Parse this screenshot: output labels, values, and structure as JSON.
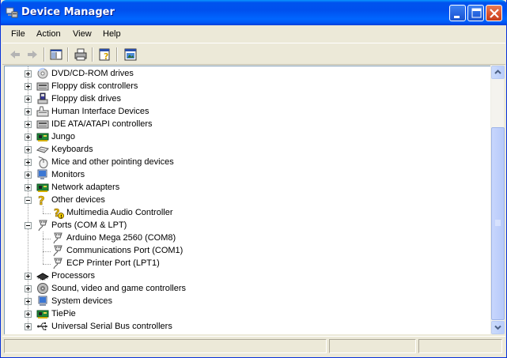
{
  "window": {
    "title": "Device Manager",
    "accent_color": "#0054e3",
    "controls": [
      "minimize-icon",
      "maximize-icon",
      "close-icon"
    ]
  },
  "menu": {
    "items": [
      "File",
      "Action",
      "View",
      "Help"
    ]
  },
  "toolbar": {
    "tools": [
      "back-arrow-icon",
      "forward-arrow-icon",
      "show-hide-console-tree-icon",
      "print-icon",
      "help-icon",
      "properties-icon"
    ]
  },
  "tree": {
    "items": [
      {
        "label": "DVD/CD-ROM drives",
        "icon": "dvd-drive-icon",
        "state": "collapsed"
      },
      {
        "label": "Floppy disk controllers",
        "icon": "controller-icon",
        "state": "collapsed"
      },
      {
        "label": "Floppy disk drives",
        "icon": "floppy-drive-icon",
        "state": "collapsed"
      },
      {
        "label": "Human Interface Devices",
        "icon": "hid-icon",
        "state": "collapsed"
      },
      {
        "label": "IDE ATA/ATAPI controllers",
        "icon": "ide-controller-icon",
        "state": "collapsed"
      },
      {
        "label": "Jungo",
        "icon": "board-icon",
        "state": "collapsed"
      },
      {
        "label": "Keyboards",
        "icon": "keyboard-icon",
        "state": "collapsed"
      },
      {
        "label": "Mice and other pointing devices",
        "icon": "mouse-icon",
        "state": "collapsed"
      },
      {
        "label": "Monitors",
        "icon": "monitor-icon",
        "state": "collapsed"
      },
      {
        "label": "Network adapters",
        "icon": "network-adapter-icon",
        "state": "collapsed"
      },
      {
        "label": "Other devices",
        "icon": "question-icon",
        "state": "expanded",
        "children": [
          {
            "label": "Multimedia Audio Controller",
            "icon": "warning-question-icon"
          }
        ]
      },
      {
        "label": "Ports (COM & LPT)",
        "icon": "port-icon",
        "state": "expanded",
        "children": [
          {
            "label": "Arduino Mega 2560 (COM8)",
            "icon": "port-icon"
          },
          {
            "label": "Communications Port (COM1)",
            "icon": "port-icon"
          },
          {
            "label": "ECP Printer Port (LPT1)",
            "icon": "port-icon"
          }
        ]
      },
      {
        "label": "Processors",
        "icon": "processor-icon",
        "state": "collapsed"
      },
      {
        "label": "Sound, video and game controllers",
        "icon": "sound-icon",
        "state": "collapsed"
      },
      {
        "label": "System devices",
        "icon": "system-icon",
        "state": "collapsed"
      },
      {
        "label": "TiePie",
        "icon": "board-icon",
        "state": "collapsed"
      },
      {
        "label": "Universal Serial Bus controllers",
        "icon": "usb-icon",
        "state": "collapsed"
      }
    ]
  },
  "statusbar": {
    "text": ""
  }
}
